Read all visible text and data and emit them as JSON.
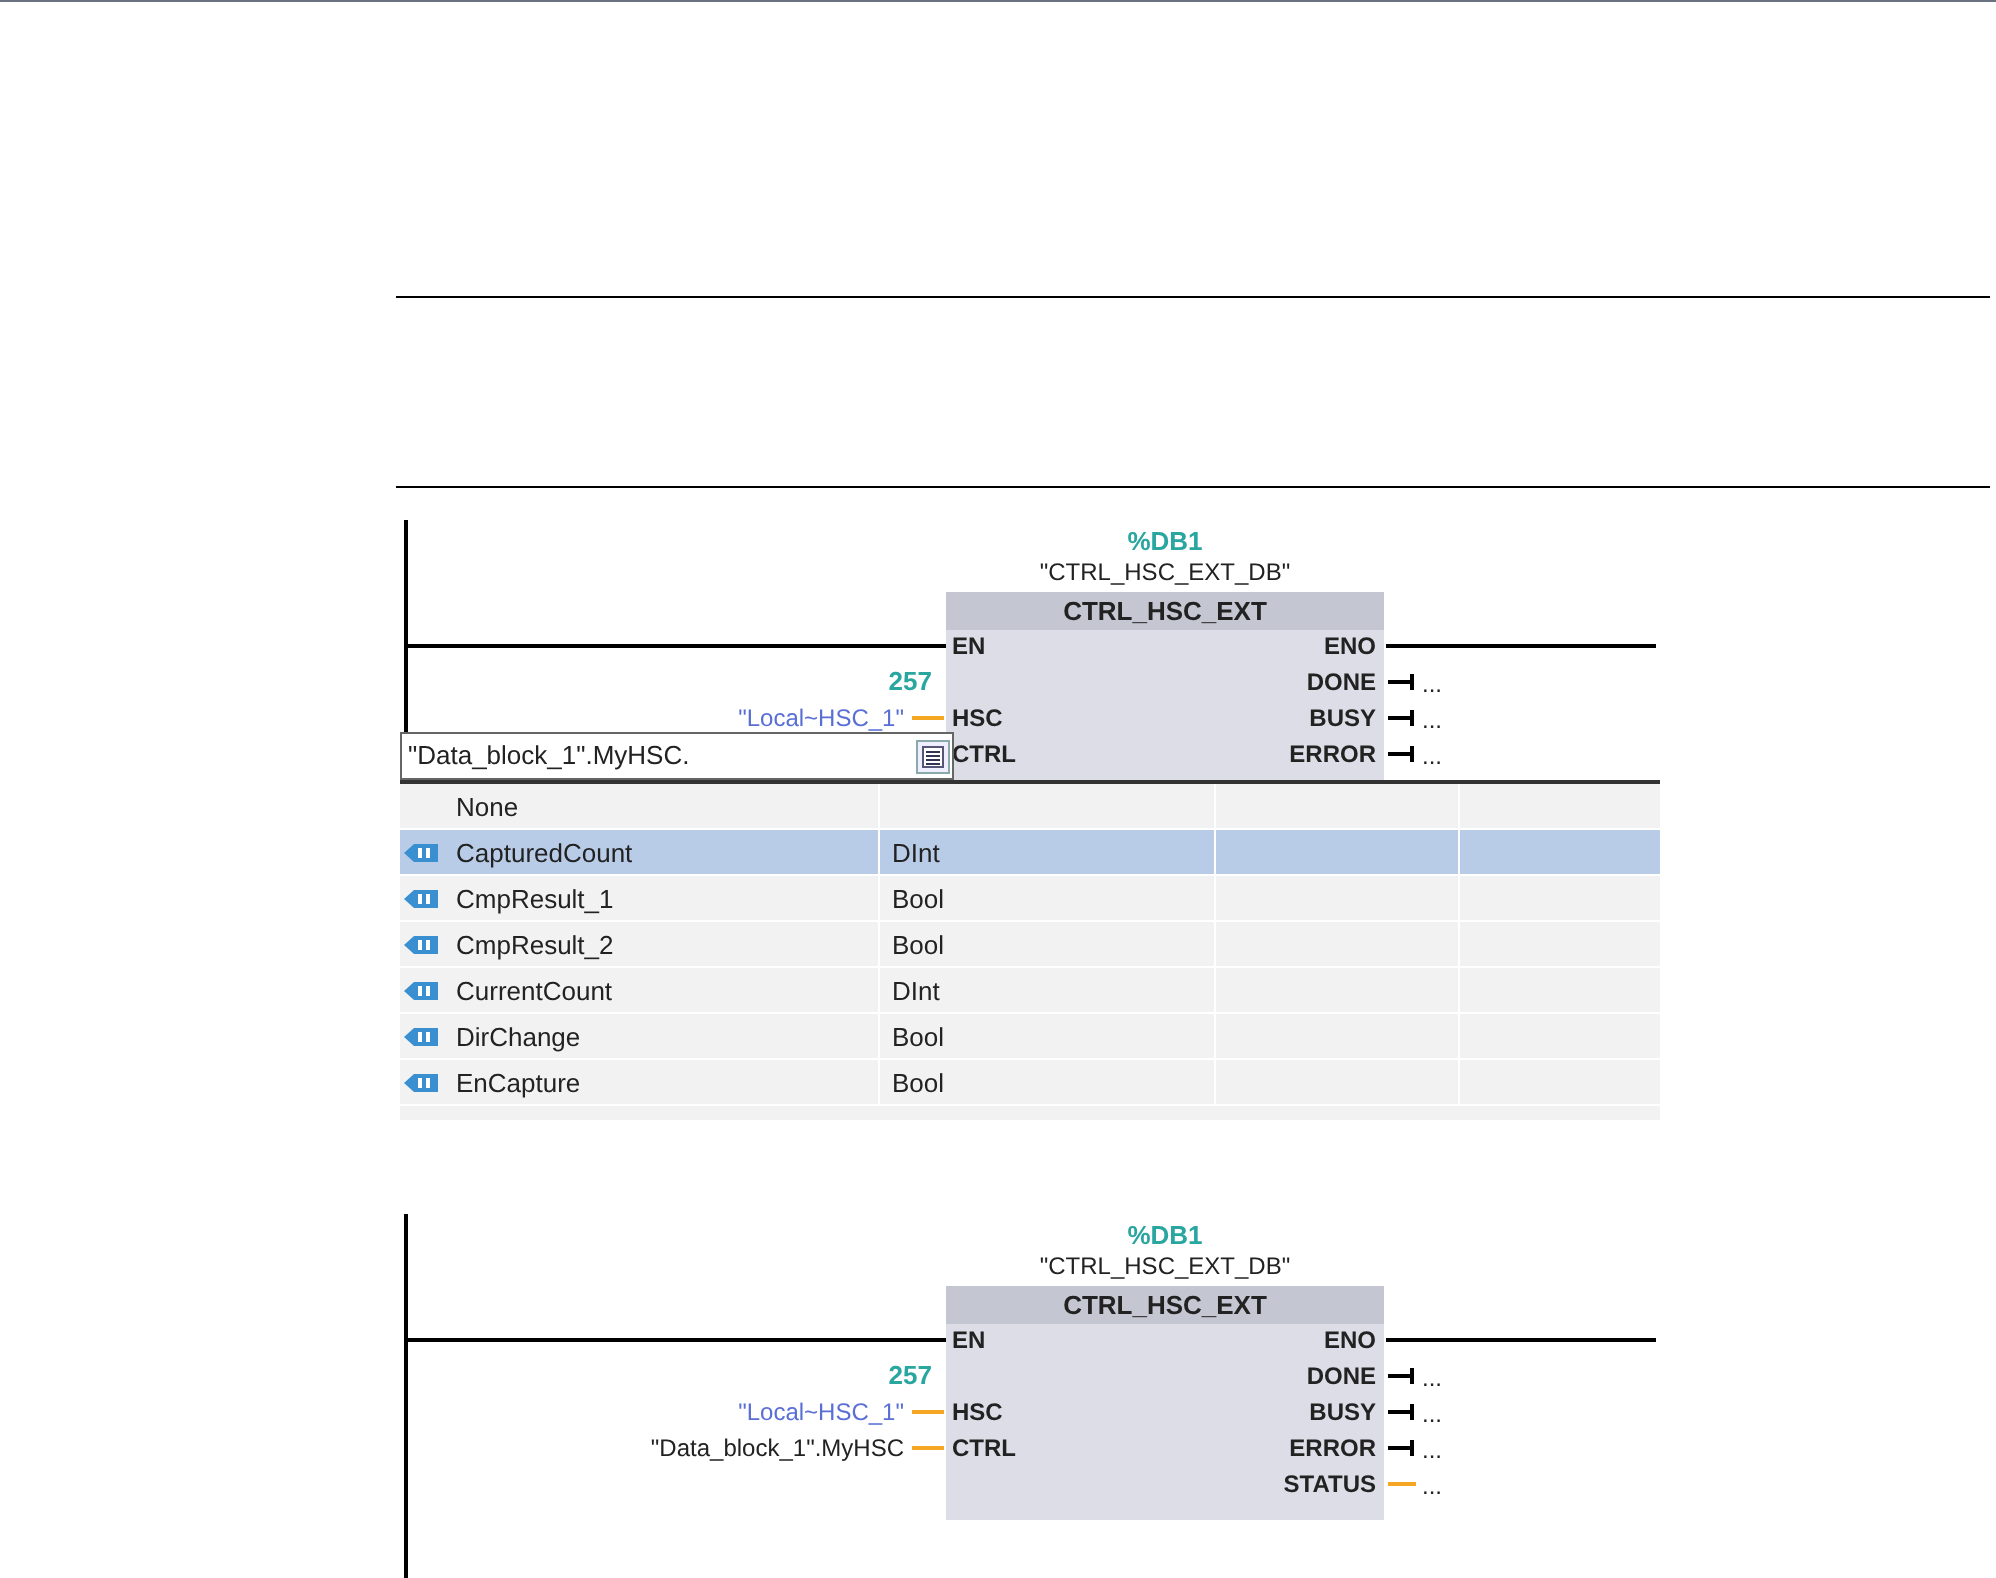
{
  "diagrams": [
    {
      "instance": "%DB1",
      "instance_db": "\"CTRL_HSC_EXT_DB\"",
      "block": "CTRL_HSC_EXT",
      "inputs": [
        {
          "pin": "EN",
          "kind": "power"
        },
        {
          "pin": "HSC",
          "kind": "word",
          "value": "\"Local~HSC_1\"",
          "color": "#5a6fd6",
          "constant": "257"
        },
        {
          "pin": "CTRL",
          "kind": "editing"
        }
      ],
      "outputs": [
        {
          "pin": "ENO",
          "kind": "power"
        },
        {
          "pin": "DONE",
          "kind": "bool",
          "value": "..."
        },
        {
          "pin": "BUSY",
          "kind": "bool",
          "value": "..."
        },
        {
          "pin": "ERROR",
          "kind": "bool",
          "value": "..."
        }
      ],
      "operand_field": {
        "value": "\"Data_block_1\".MyHSC."
      },
      "dropdown": {
        "rows": [
          {
            "kind": "none",
            "name": "None",
            "selected": false
          },
          {
            "kind": "tag",
            "name": "CapturedCount",
            "type": "DInt",
            "selected": true
          },
          {
            "kind": "tag",
            "name": "CmpResult_1",
            "type": "Bool",
            "selected": false
          },
          {
            "kind": "tag",
            "name": "CmpResult_2",
            "type": "Bool",
            "selected": false
          },
          {
            "kind": "tag",
            "name": "CurrentCount",
            "type": "DInt",
            "selected": false
          },
          {
            "kind": "tag",
            "name": "DirChange",
            "type": "Bool",
            "selected": false
          },
          {
            "kind": "tag",
            "name": "EnCapture",
            "type": "Bool",
            "selected": false
          }
        ]
      }
    },
    {
      "instance": "%DB1",
      "instance_db": "\"CTRL_HSC_EXT_DB\"",
      "block": "CTRL_HSC_EXT",
      "inputs": [
        {
          "pin": "EN",
          "kind": "power"
        },
        {
          "pin": "HSC",
          "kind": "word",
          "value": "\"Local~HSC_1\"",
          "color": "#5a6fd6",
          "constant": "257"
        },
        {
          "pin": "CTRL",
          "kind": "word",
          "value": "\"Data_block_1\".MyHSC",
          "color": "#222222"
        }
      ],
      "outputs": [
        {
          "pin": "ENO",
          "kind": "power"
        },
        {
          "pin": "DONE",
          "kind": "bool",
          "value": "..."
        },
        {
          "pin": "BUSY",
          "kind": "bool",
          "value": "..."
        },
        {
          "pin": "ERROR",
          "kind": "bool",
          "value": "..."
        },
        {
          "pin": "STATUS",
          "kind": "word",
          "value": "..."
        }
      ]
    }
  ]
}
